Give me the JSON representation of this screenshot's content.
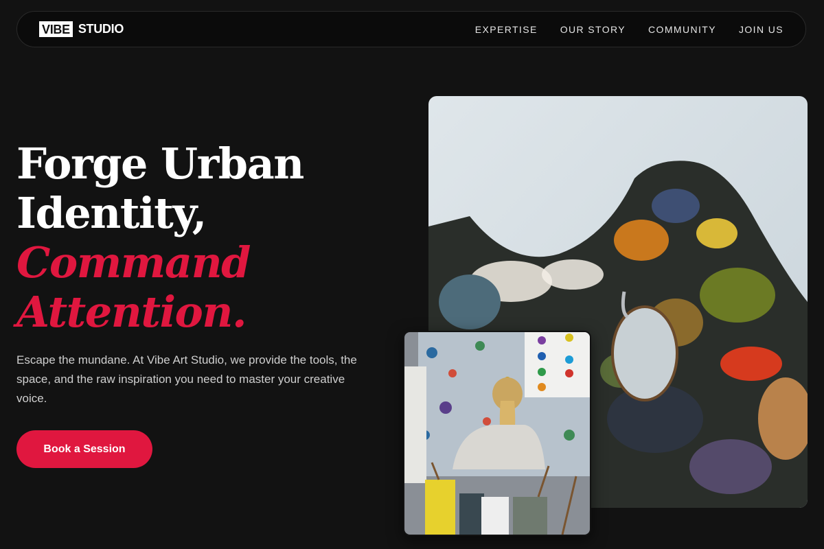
{
  "nav": {
    "logo_box": "VIBE",
    "logo_text": "STUDIO",
    "links": [
      "EXPERTISE",
      "OUR STORY",
      "COMMUNITY",
      "JOIN US"
    ]
  },
  "hero": {
    "line1": "Forge Urban",
    "line2": "Identity,",
    "line3": "Command",
    "line4": "Attention.",
    "description": "Escape the mundane. At Vibe Art Studio, we provide the tools, the space, and the raw inspiration you need to master your creative voice.",
    "cta_label": "Book a Session"
  },
  "colors": {
    "background": "#121212",
    "accent": "#e0173f",
    "text": "#ffffff"
  }
}
